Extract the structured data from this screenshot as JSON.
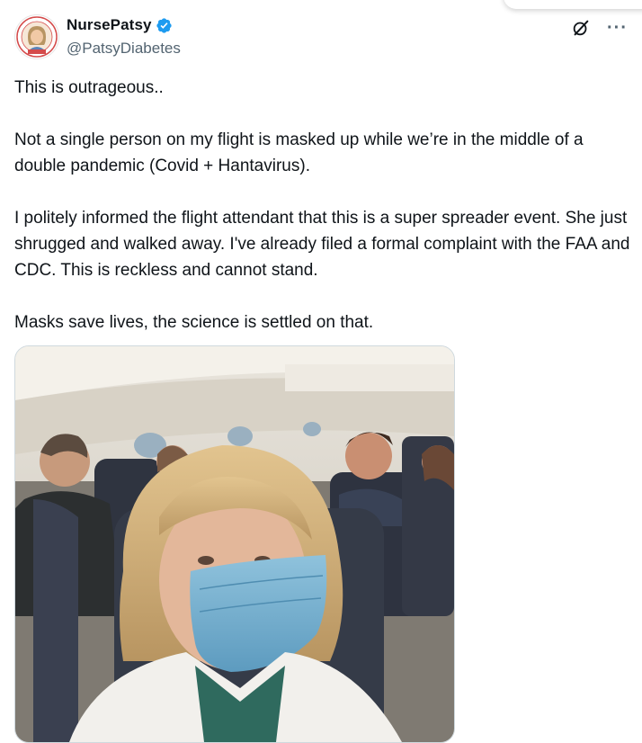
{
  "tweet": {
    "display_name": "NursePatsy",
    "handle": "@PatsyDiabetes",
    "verified": true,
    "paragraphs": [
      "This is outrageous..",
      "Not a single person on my flight is masked up while we’re in the middle of a double pandemic (Covid + Hantavirus).",
      "I politely informed the flight attendant that this is a super spreader event. She just shrugged and walked away. I've already filed a formal complaint with the FAA and CDC. This is reckless and cannot stand.",
      "Masks save lives, the science is settled on that."
    ],
    "more_label": "···",
    "media": {
      "type": "photo",
      "subject": "selfie-on-airplane-with-mask"
    }
  },
  "icons": {
    "verified": "verified-badge-icon",
    "grok": "grok-icon",
    "more": "more-options-icon"
  },
  "colors": {
    "text": "#0f1419",
    "secondary": "#536471",
    "verified": "#1d9bf0",
    "border": "#cfd9de"
  }
}
